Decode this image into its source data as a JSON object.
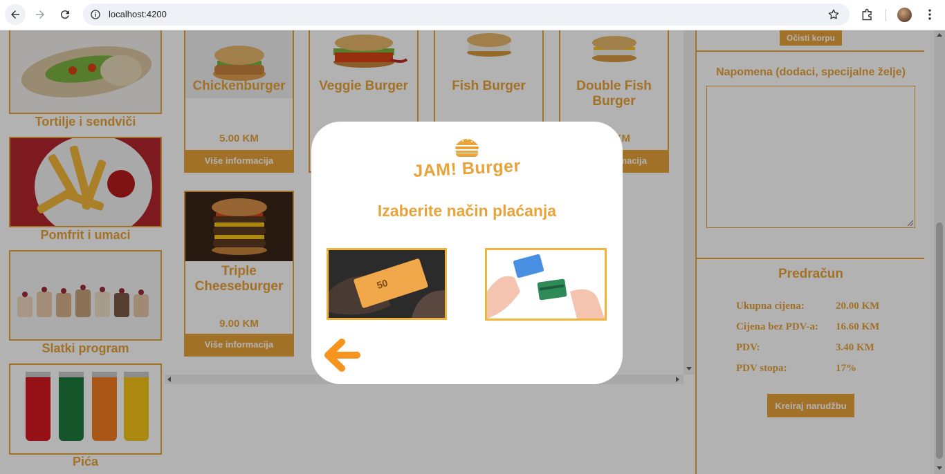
{
  "browser": {
    "url": "localhost:4200"
  },
  "categories": [
    {
      "label": "Tortilje i sendviči"
    },
    {
      "label": "Pomfrit i umaci"
    },
    {
      "label": "Slatki program"
    },
    {
      "label": "Pića"
    }
  ],
  "products": [
    {
      "name": "Chickenburger",
      "price": "5.00 KM",
      "button": "Više informacija"
    },
    {
      "name": "Veggie Burger",
      "price": "",
      "button": ""
    },
    {
      "name": "Fish Burger",
      "price": "",
      "button": ""
    },
    {
      "name": "Double Fish Burger",
      "price": "KM",
      "button": "macija"
    },
    {
      "name": "Triple Cheeseburger",
      "price": "9.00 KM",
      "button": "Više informacija"
    }
  ],
  "cart": {
    "clear_label": "Očisti korpu",
    "note_label": "Napomena (dodaci, specijalne želje)",
    "note_value": ""
  },
  "receipt": {
    "title": "Predračun",
    "rows": [
      {
        "label": "Ukupna cijena:",
        "value": "20.00 KM"
      },
      {
        "label": "Cijena bez PDV-a:",
        "value": "16.60 KM"
      },
      {
        "label": "PDV:",
        "value": "3.40 KM"
      },
      {
        "label": "PDV stopa:",
        "value": "17%"
      }
    ],
    "order_label": "Kreiraj narudžbu"
  },
  "modal": {
    "brand": "JAM! Burger",
    "title": "Izaberite način plaćanja"
  },
  "colors": {
    "accent": "#e8a33a"
  }
}
